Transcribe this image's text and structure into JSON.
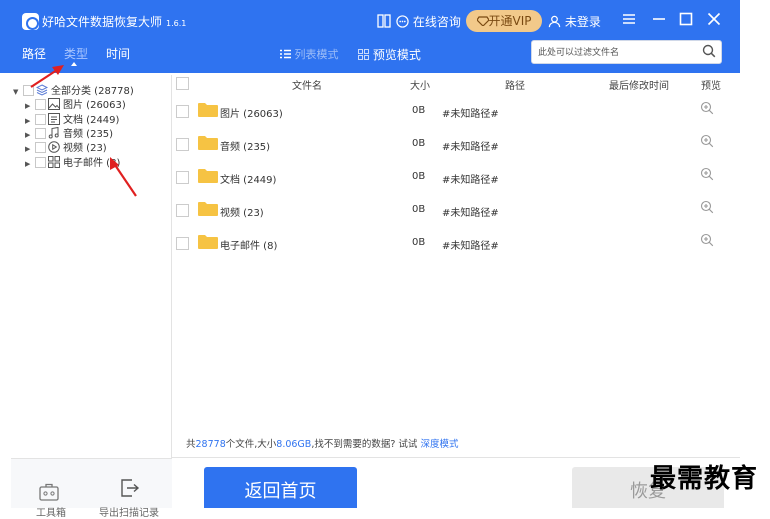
{
  "app": {
    "title": "好哈文件数据恢复大师",
    "version": "1.6.1",
    "consult_label": "在线咨询",
    "vip_label": "开通VIP",
    "login_label": "未登录"
  },
  "nav": {
    "tabs": [
      {
        "label": "路径"
      },
      {
        "label": "类型"
      },
      {
        "label": "时间"
      }
    ],
    "active_tab": "类型",
    "list_mode_label": "列表模式",
    "preview_mode_label": "预览模式"
  },
  "search": {
    "placeholder": "此处可以过滤文件名"
  },
  "tree": {
    "root": {
      "label": "全部分类 (28778)"
    },
    "children": [
      {
        "label": "图片 (26063)",
        "icon": "image-icon"
      },
      {
        "label": "文档 (2449)",
        "icon": "document-icon"
      },
      {
        "label": "音频 (235)",
        "icon": "music-icon"
      },
      {
        "label": "视频 (23)",
        "icon": "play-icon"
      },
      {
        "label": "电子邮件 (8)",
        "icon": "grid-icon"
      }
    ]
  },
  "table": {
    "columns": {
      "name": "文件名",
      "size": "大小",
      "path": "路径",
      "modified": "最后修改时间",
      "preview": "预览"
    },
    "rows": [
      {
        "name": "图片 (26063)",
        "size": "0B",
        "path": "#未知路径#"
      },
      {
        "name": "音频 (235)",
        "size": "0B",
        "path": "#未知路径#"
      },
      {
        "name": "文档 (2449)",
        "size": "0B",
        "path": "#未知路径#"
      },
      {
        "name": "视频 (23)",
        "size": "0B",
        "path": "#未知路径#"
      },
      {
        "name": "电子邮件 (8)",
        "size": "0B",
        "path": "#未知路径#"
      }
    ]
  },
  "summary": {
    "prefix": "共",
    "count": "28778",
    "mid": "个文件,大小",
    "size": "8.06GB",
    "suffix": ",找不到需要的数据? 试试",
    "link": "深度模式"
  },
  "bottom": {
    "toolbox_label": "工具箱",
    "export_label": "导出扫描记录",
    "home_button": "返回首页",
    "recover_button": "恢复"
  },
  "watermark": "最需教育",
  "colors": {
    "primary": "#2f73f0",
    "vip": "#f2c98a",
    "folder": "#f6c343",
    "annotation_arrow": "#e02020"
  }
}
